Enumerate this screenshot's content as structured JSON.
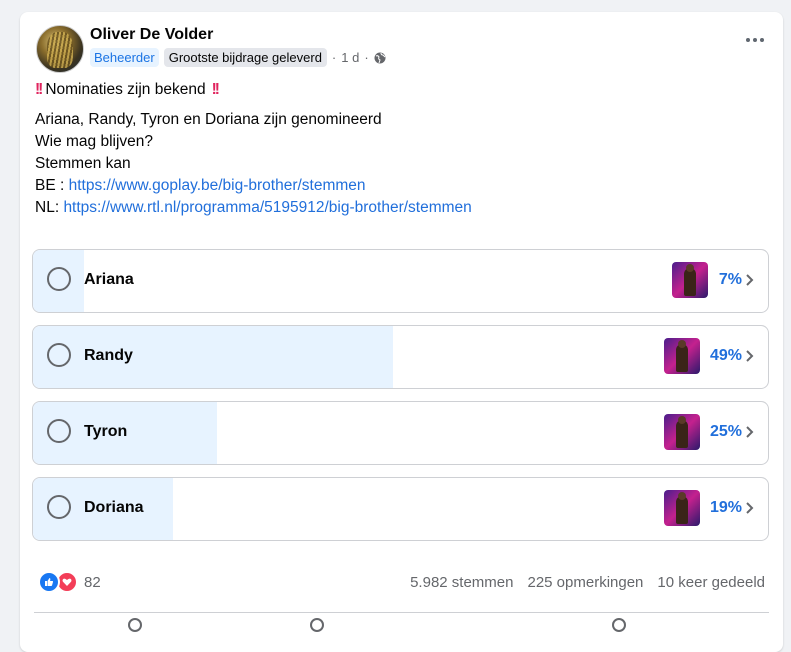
{
  "post": {
    "author": "Oliver De Volder",
    "badge_admin": "Beheerder",
    "badge_top": "Grootste bijdrage geleverd",
    "separator": "·",
    "time": "1 d",
    "sep2": "·",
    "headline": "Nominaties zijn bekend",
    "line1": "Ariana, Randy,  Tyron en Doriana zijn genomineerd",
    "line2": "Wie mag blijven?",
    "line3": "Stemmen kan",
    "be_label": "BE :",
    "be_link": "https://www.goplay.be/big-brother/stemmen",
    "nl_label": "NL:",
    "nl_link": "https://www.rtl.nl/programma/5195912/big-brother/stemmen"
  },
  "poll": {
    "options": [
      {
        "label": "Ariana",
        "percent_text": "7%",
        "percent": 7
      },
      {
        "label": "Randy",
        "percent_text": "49%",
        "percent": 49
      },
      {
        "label": "Tyron",
        "percent_text": "25%",
        "percent": 25
      },
      {
        "label": "Doriana",
        "percent_text": "19%",
        "percent": 19
      }
    ]
  },
  "footer": {
    "reaction_count": "82",
    "votes": "5.982 stemmen",
    "comments": "225 opmerkingen",
    "shares": "10 keer gedeeld"
  },
  "colors": {
    "accent": "#216fdb",
    "poll_fill": "#e7f3ff",
    "like": "#1877f2",
    "love": "#f33e58"
  },
  "icons": [
    "globe-icon",
    "more-icon",
    "bang-icon",
    "radio-icon",
    "chevron-right-icon",
    "like-icon",
    "love-icon"
  ]
}
